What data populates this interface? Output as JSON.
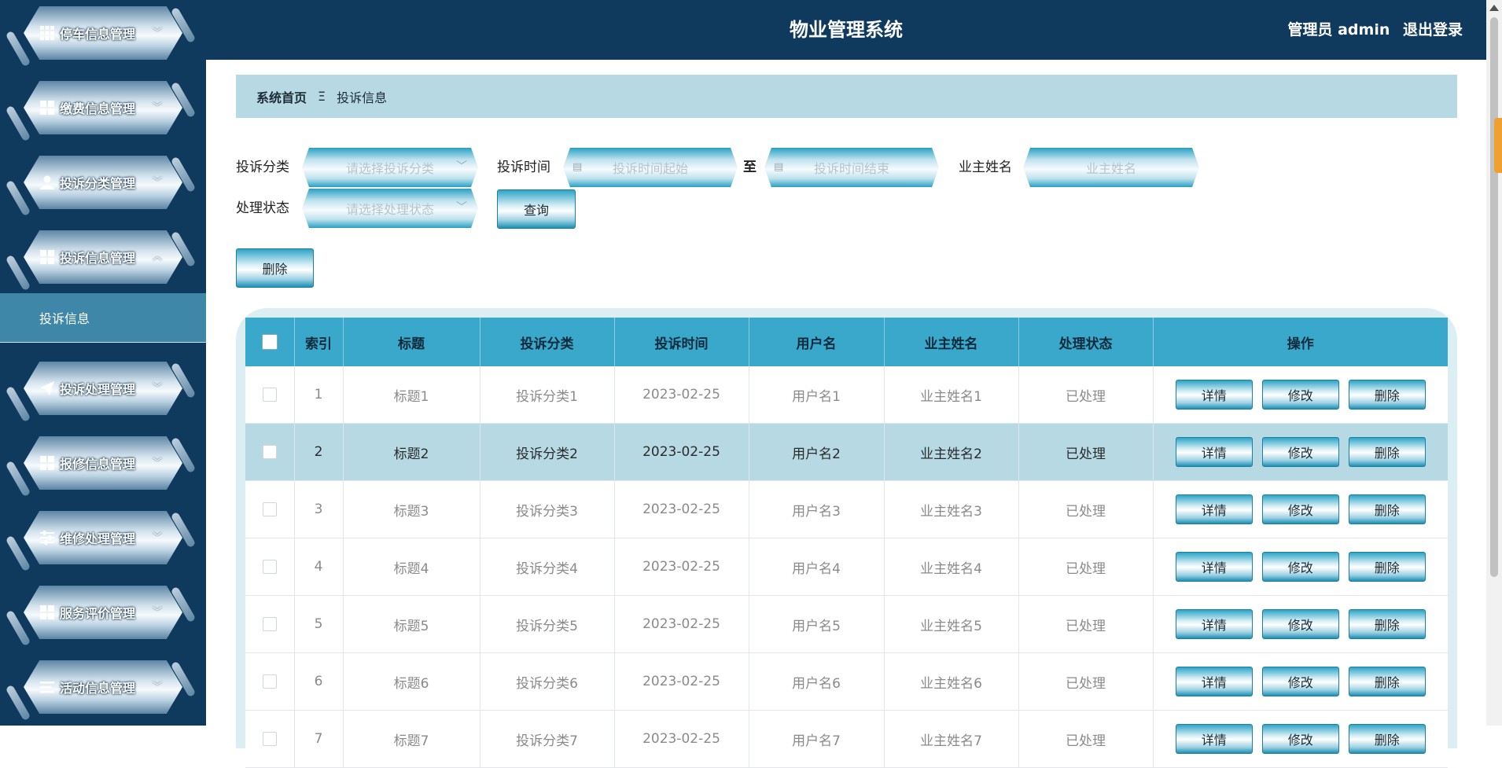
{
  "header": {
    "title": "物业管理系统",
    "user_label": "管理员 admin",
    "logout_label": "退出登录"
  },
  "sidebar": {
    "items": [
      {
        "label": "停车信息管理",
        "icon": "grid-icon",
        "expanded": false
      },
      {
        "label": "缴费信息管理",
        "icon": "grid-icon",
        "expanded": false
      },
      {
        "label": "投诉分类管理",
        "icon": "user-icon",
        "expanded": false
      },
      {
        "label": "投诉信息管理",
        "icon": "grid-icon",
        "expanded": true
      },
      {
        "label": "投诉处理管理",
        "icon": "send-icon",
        "expanded": false
      },
      {
        "label": "报修信息管理",
        "icon": "grid-icon",
        "expanded": false
      },
      {
        "label": "维修处理管理",
        "icon": "sliders-icon",
        "expanded": false
      },
      {
        "label": "服务评价管理",
        "icon": "grid-icon",
        "expanded": false
      },
      {
        "label": "活动信息管理",
        "icon": "list-icon",
        "expanded": false
      }
    ],
    "submenu": {
      "label": "投诉信息"
    }
  },
  "breadcrumb": {
    "home": "系统首页",
    "separator": "Ξ",
    "current": "投诉信息"
  },
  "search": {
    "category_label": "投诉分类",
    "category_placeholder": "请选择投诉分类",
    "time_label": "投诉时间",
    "time_start_placeholder": "投诉时间起始",
    "time_to": "至",
    "time_end_placeholder": "投诉时间结束",
    "owner_label": "业主姓名",
    "owner_placeholder": "业主姓名",
    "status_label": "处理状态",
    "status_placeholder": "请选择处理状态",
    "query_button": "查询",
    "delete_button": "删除"
  },
  "table": {
    "columns": [
      "索引",
      "标题",
      "投诉分类",
      "投诉时间",
      "用户名",
      "业主姓名",
      "处理状态",
      "操作"
    ],
    "actions": {
      "detail": "详情",
      "edit": "修改",
      "delete": "删除"
    },
    "rows": [
      {
        "index": "1",
        "title": "标题1",
        "category": "投诉分类1",
        "time": "2023-02-25",
        "username": "用户名1",
        "owner": "业主姓名1",
        "status": "已处理"
      },
      {
        "index": "2",
        "title": "标题2",
        "category": "投诉分类2",
        "time": "2023-02-25",
        "username": "用户名2",
        "owner": "业主姓名2",
        "status": "已处理"
      },
      {
        "index": "3",
        "title": "标题3",
        "category": "投诉分类3",
        "time": "2023-02-25",
        "username": "用户名3",
        "owner": "业主姓名3",
        "status": "已处理"
      },
      {
        "index": "4",
        "title": "标题4",
        "category": "投诉分类4",
        "time": "2023-02-25",
        "username": "用户名4",
        "owner": "业主姓名4",
        "status": "已处理"
      },
      {
        "index": "5",
        "title": "标题5",
        "category": "投诉分类5",
        "time": "2023-02-25",
        "username": "用户名5",
        "owner": "业主姓名5",
        "status": "已处理"
      },
      {
        "index": "6",
        "title": "标题6",
        "category": "投诉分类6",
        "time": "2023-02-25",
        "username": "用户名6",
        "owner": "业主姓名6",
        "status": "已处理"
      },
      {
        "index": "7",
        "title": "标题7",
        "category": "投诉分类7",
        "time": "2023-02-25",
        "username": "用户名7",
        "owner": "业主姓名7",
        "status": "已处理"
      }
    ]
  },
  "colors": {
    "navy": "#0f3a5e",
    "accent": "#3aa8ca",
    "highlight_row": "#b6d9e4",
    "submenu": "#3f87a8"
  }
}
